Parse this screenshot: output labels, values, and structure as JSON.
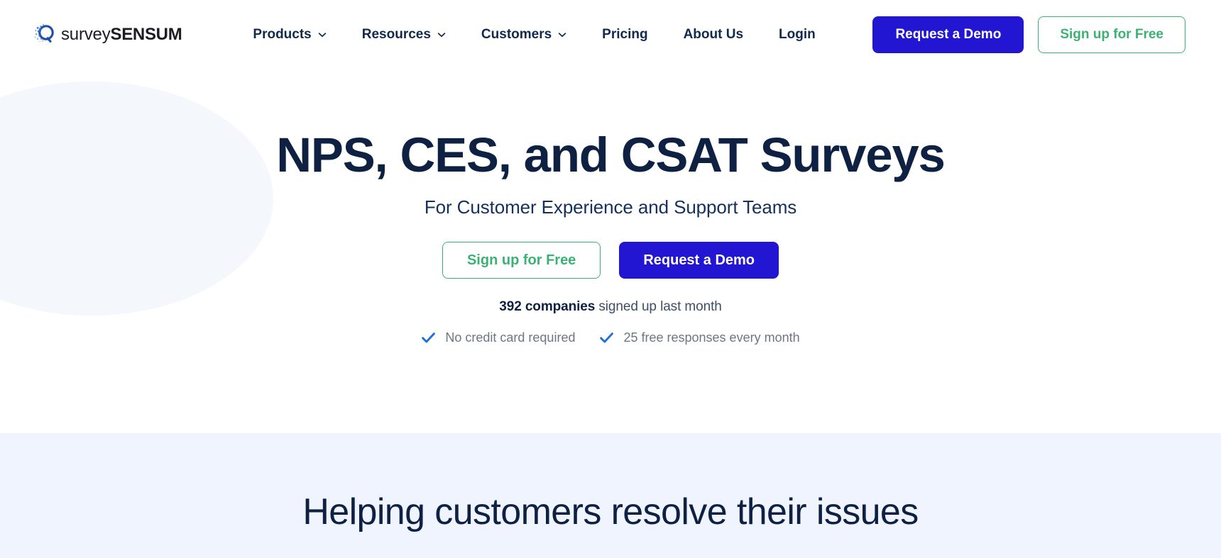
{
  "header": {
    "logo": {
      "icon": "survey-sensum-logo-icon",
      "text_light": "survey",
      "text_bold": "SENSUM"
    },
    "nav": [
      {
        "label": "Products",
        "has_dropdown": true,
        "icon": "chevron-down-icon"
      },
      {
        "label": "Resources",
        "has_dropdown": true,
        "icon": "chevron-down-icon"
      },
      {
        "label": "Customers",
        "has_dropdown": true,
        "icon": "chevron-down-icon"
      },
      {
        "label": "Pricing",
        "has_dropdown": false
      },
      {
        "label": "About Us",
        "has_dropdown": false
      },
      {
        "label": "Login",
        "has_dropdown": false
      }
    ],
    "demo_button": "Request a Demo",
    "signup_button": "Sign up for Free"
  },
  "hero": {
    "title": "NPS, CES, and CSAT Surveys",
    "subtitle": "For Customer Experience and Support Teams",
    "signup_button": "Sign up for Free",
    "demo_button": "Request a Demo",
    "social_proof_bold": "392 companies",
    "social_proof_rest": " signed up last month",
    "perks": [
      {
        "icon": "check-icon",
        "label": "No credit card required"
      },
      {
        "icon": "check-icon",
        "label": "25 free responses every month"
      }
    ]
  },
  "band": {
    "title": "Helping customers resolve their issues"
  },
  "colors": {
    "primary_blue": "#2316d3",
    "accent_green": "#3bb273",
    "heading_navy": "#0f2143",
    "check_blue": "#1f6fd8",
    "band_bg": "#eff4fe",
    "blob_bg": "#f4f7fc"
  }
}
